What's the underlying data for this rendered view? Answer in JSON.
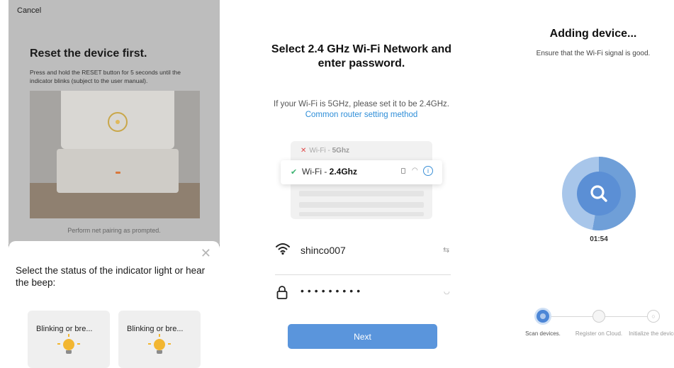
{
  "panel1": {
    "cancel_label": "Cancel",
    "title": "Reset the device first.",
    "description": "Press and hold the RESET button for 5 seconds until the indicator blinks (subject to the user manual).",
    "pairing_note": "Perform net pairing as prompted.",
    "sheet": {
      "close_icon": "close-icon",
      "prompt": "Select the status of the indicator light or hear the beep:",
      "options": [
        {
          "label": "Blinking or bre...",
          "icon": "bulb-icon"
        },
        {
          "label": "Blinking or bre...",
          "icon": "bulb-icon"
        }
      ]
    }
  },
  "panel2": {
    "title": "Select 2.4 GHz Wi-Fi Network and enter password.",
    "hint_text": "If your Wi-Fi is 5GHz, please set it to be 2.4GHz.",
    "hint_link": "Common router setting method",
    "wifi_5g": {
      "prefix": "Wi-Fi - ",
      "band": "5Ghz",
      "status_icon": "cross-icon"
    },
    "wifi_24g": {
      "prefix": "Wi-Fi - ",
      "band": "2.4Ghz",
      "status_icon": "check-icon"
    },
    "ssid": "shinco007",
    "password_mask": "•••••••••",
    "next_label": "Next",
    "colors": {
      "accent": "#5a95dc",
      "link": "#2f8ed8"
    }
  },
  "panel3": {
    "title": "Adding device...",
    "subtitle": "Ensure that the Wi-Fi signal is good.",
    "timer": "01:54",
    "steps": [
      {
        "label": "Scan devices.",
        "active": true
      },
      {
        "label": "Register on Cloud.",
        "active": false
      },
      {
        "label": "Initialize the device.",
        "active": false
      }
    ],
    "colors": {
      "ring": "#5b8fd5",
      "ring_light": "#a8c6ea"
    }
  }
}
